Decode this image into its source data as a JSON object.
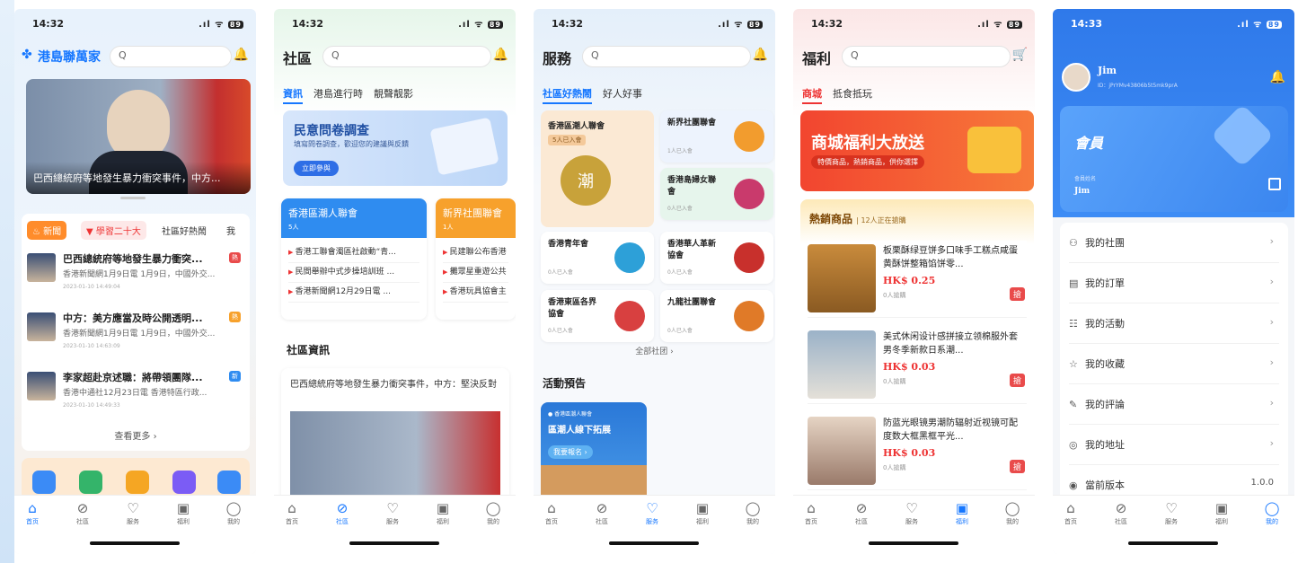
{
  "nav_labels": [
    "首页",
    "社區",
    "服务",
    "福利",
    "我的"
  ],
  "nav_icons": [
    "home-icon",
    "compass-icon",
    "heart-icon",
    "bag-icon",
    "person-icon"
  ],
  "p1": {
    "time": "14:32",
    "signal": "5G",
    "battery": "89",
    "app_name": "港島聯萬家",
    "banner_caption": "巴西總統府等地發生暴力衝突事件，中方...",
    "tabs": [
      "新聞",
      "學習二十大",
      "社區好熱鬧",
      "我"
    ],
    "news": [
      {
        "title": "巴西總統府等地發生暴力衝突...",
        "snippet": "香港新聞網1月9日電 1月9日，中國外交...",
        "time": "2023-01-10 14:49:04",
        "badge": "熱"
      },
      {
        "title": "中方：美方應當及時公開透明...",
        "snippet": "香港新聞網1月9日電 1月9日，中國外交...",
        "time": "2023-01-10 14:63:09",
        "badge": "熱"
      },
      {
        "title": "李家超赴京述職：將帶領團隊...",
        "snippet": "香港中通社12月23日電 香港特區行政...",
        "time": "2023-01-10 14:49:33",
        "badge": "新"
      }
    ],
    "more": "查看更多 ›"
  },
  "p2": {
    "time": "14:32",
    "title": "社區",
    "tabs": [
      "資訊",
      "港島進行時",
      "靚聲靓影"
    ],
    "survey_title": "民意問卷調查",
    "survey_sub": "填寫問卷調查，歡迎您的建議與反饋",
    "survey_btn": "立即參與",
    "club1_name": "香港區潮人聯會",
    "club1_count": "5人",
    "club1_items": [
      "香港工聯會濁區社啟動“青...",
      "民間舉辦中式步操培訓班 ...",
      "香港新聞網12月29日電 ..."
    ],
    "club2_name": "新界社團聯會",
    "club2_count": "1人",
    "club2_items": [
      "民建聯公布香港",
      "攤眾星重遊公共",
      "香港玩具協會主"
    ],
    "section": "社區資訊",
    "article": "巴西總統府等地發生暴力衝突事件，中方：堅決反對"
  },
  "p3": {
    "time": "14:32",
    "title": "服務",
    "tabs": [
      "社區好熱鬧",
      "好人好事"
    ],
    "feature": {
      "name": "香港區潮人聯會",
      "joined": "5人已入會"
    },
    "orgs": [
      {
        "name": "新界社團聯會",
        "joined": "1人已入會"
      },
      {
        "name": "香港島婦女聯會",
        "joined": "0人已入會"
      },
      {
        "name": "香港青年會",
        "joined": "0人已入會"
      },
      {
        "name": "香港華人革新協會",
        "joined": "0人已入會"
      },
      {
        "name": "香港東區各界協會",
        "joined": "0人已入會"
      },
      {
        "name": "九龍社團聯會",
        "joined": "0人已入會"
      }
    ],
    "all": "全部社团 ›",
    "events": "活動預告",
    "event_org": "香港區潮人聯會",
    "event_title": "區潮人線下拓展",
    "event_btn": "我要報名 ›"
  },
  "p4": {
    "time": "14:32",
    "title": "福利",
    "tabs": [
      "商城",
      "抵食抵玩"
    ],
    "promo_title": "商城福利大放送",
    "promo_sub": "特價商品，熱銷商品，供你選擇",
    "hot": "熱銷商品",
    "hot_count": "12人正在搶購",
    "products": [
      {
        "name": "板栗酥绿豆饼多口味手工糕点咸蛋黄酥饼整箱馅饼零...",
        "price": "HK$ 0.25",
        "sold": "0人搶購"
      },
      {
        "name": "美式休闲设计感拼接立领棉服外套男冬季新款日系潮...",
        "price": "HK$ 0.03",
        "sold": "0人搶購"
      },
      {
        "name": "防蓝光眼镜男潮防辐射近视镜可配度数大框黑框平光...",
        "price": "HK$ 0.03",
        "sold": "0人搶購"
      }
    ],
    "grab": "搶"
  },
  "p5": {
    "time": "14:33",
    "name": "Jim",
    "id": "ID：jPrYMv43806b5t5mk9prA",
    "member": "會員",
    "member_label": "會員姓名",
    "member_name": "Jim",
    "menu": [
      "我的社團",
      "我的訂單",
      "我的活動",
      "我的收藏",
      "我的評論",
      "我的地址",
      "當前版本"
    ],
    "menu_icons": [
      "group-icon",
      "order-icon",
      "event-icon",
      "favorite-icon",
      "comment-icon",
      "address-icon",
      "version-icon"
    ],
    "version": "1.0.0"
  }
}
